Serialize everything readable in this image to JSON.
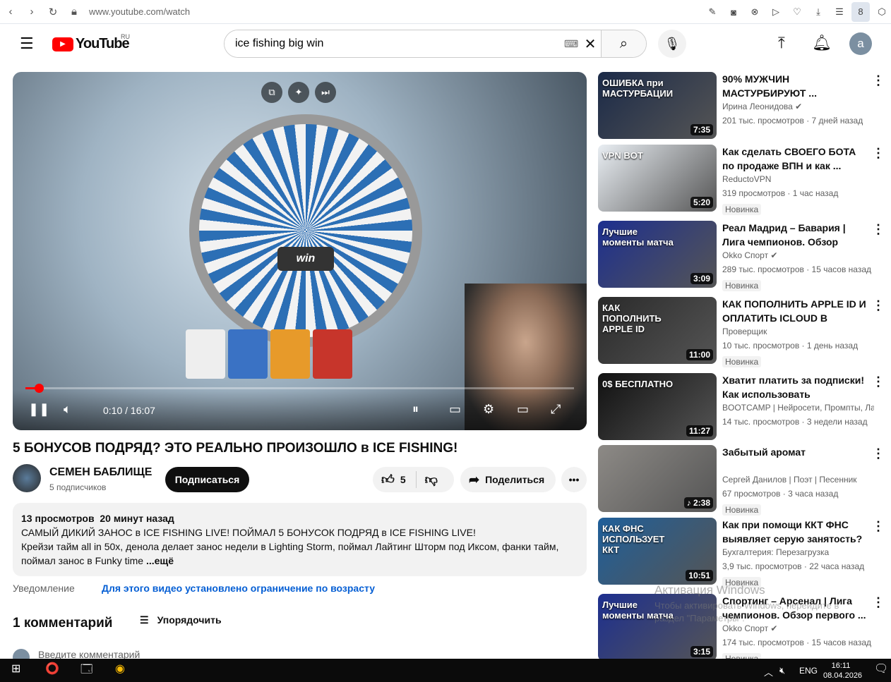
{
  "browser": {
    "url": "www.youtube.com/watch"
  },
  "header": {
    "logo": "YouTube",
    "region": "RU",
    "search_value": "ice fishing big win",
    "avatar_letter": "a"
  },
  "player": {
    "time": "0:10 / 16:07",
    "progress_fraction": 0.0104,
    "win_label": "win"
  },
  "video": {
    "title": "5 БОНУСОВ ПОДРЯД? ЭТО РЕАЛЬНО ПРОИЗОШЛО в ICE FISHING!",
    "channel": "СЕМЕН БАБЛИЩЕ",
    "subscribers": "5 подписчиков",
    "subscribe_label": "Подписаться",
    "likes": "5",
    "share_label": "Поделиться"
  },
  "description": {
    "views": "13 просмотров",
    "date": "20 минут назад",
    "line1": "САМЫЙ ДИКИЙ ЗАНОС в ICE FISHING LIVE! ПОЙМАЛ 5 БОНУСОК ПОДРЯД в ICE FISHING LIVE!",
    "line2": "Крейзи тайм all in 50x, денола делает занос недели в Lighting Storm, поймал Лайтинг Шторм под Иксом, фанки тайм,",
    "line3": "поймал занос в Funky time",
    "more": "...ещё"
  },
  "notice": {
    "label": "Уведомление",
    "link": "Для этого видео установлено ограничение по возрасту"
  },
  "comments": {
    "count": "1 комментарий",
    "sort": "Упорядочить",
    "placeholder": "Введите комментарий"
  },
  "sidebar": [
    {
      "title": "90% МУЖЧИН МАСТУРБИРУЮТ ...",
      "channel": "Ирина Леонидова ✔",
      "meta": "201 тыс. просмотров · 7 дней назад",
      "badge": "",
      "duration": "7:35",
      "caption": "ОШИБКА при МАСТУРБАЦИИ",
      "color": "#1b2a48"
    },
    {
      "title": "Как сделать СВОЕГО БОТА по продаже ВПН и как ...",
      "channel": "ReductoVPN",
      "meta": "319 просмотров · 1 час назад",
      "badge": "Новинка",
      "duration": "5:20",
      "caption": "VPN BOT",
      "color": "#e9eef3"
    },
    {
      "title": "Реал Мадрид – Бавария | Лига чемпионов. Обзор первого ...",
      "channel": "Okko Спорт ✔",
      "meta": "289 тыс. просмотров · 15 часов назад",
      "badge": "Новинка",
      "duration": "3:09",
      "caption": "Лучшие моменты матча",
      "color": "#1d2f8f"
    },
    {
      "title": "КАК ПОПОЛНИТЬ APPLE ID И ОПЛАТИТЬ ICLOUD В РОССИ...",
      "channel": "Проверщик",
      "meta": "10 тыс. просмотров · 1 день назад",
      "badge": "Новинка",
      "duration": "11:00",
      "caption": "КАК ПОПОЛНИТЬ APPLE ID",
      "color": "#2a2a2a"
    },
    {
      "title": "Хватит платить за подписки! Как использовать ПЛАТНЫЕ...",
      "channel": "BOOTCAMP | Нейросети, Промпты, Ла...",
      "meta": "14 тыс. просмотров · 3 недели назад",
      "badge": "",
      "duration": "11:27",
      "caption": "0$ БЕСПЛАТНО",
      "color": "#111"
    },
    {
      "title": "Забытый аромат",
      "channel": "Сергей Данилов | Поэт | Песенник",
      "meta": "67 просмотров · 3 часа назад",
      "badge": "Новинка",
      "duration": "♪ 2:38",
      "caption": "",
      "color": "#8d8a86"
    },
    {
      "title": "Как при помощи ККТ ФНС выявляет серую занятость?",
      "channel": "Бухгалтерия: Перезагрузка",
      "meta": "3,9 тыс. просмотров · 22 часа назад",
      "badge": "Новинка",
      "duration": "10:51",
      "caption": "КАК ФНС ИСПОЛЬЗУЕТ ККТ",
      "color": "#1f5f9a"
    },
    {
      "title": "Спортинг – Арсенал | Лига чемпионов. Обзор первого ...",
      "channel": "Okko Спорт ✔",
      "meta": "174 тыс. просмотров · 15 часов назад",
      "badge": "Новинка",
      "duration": "3:15",
      "caption": "Лучшие моменты матча",
      "color": "#1d2f8f"
    }
  ],
  "watermark": {
    "title": "Активация Windows",
    "text": "Чтобы активировать Windows, перейдите в раздел \"Параметры\"."
  },
  "taskbar": {
    "lang": "ENG",
    "time": "16:11",
    "date": "08.04.2026"
  }
}
